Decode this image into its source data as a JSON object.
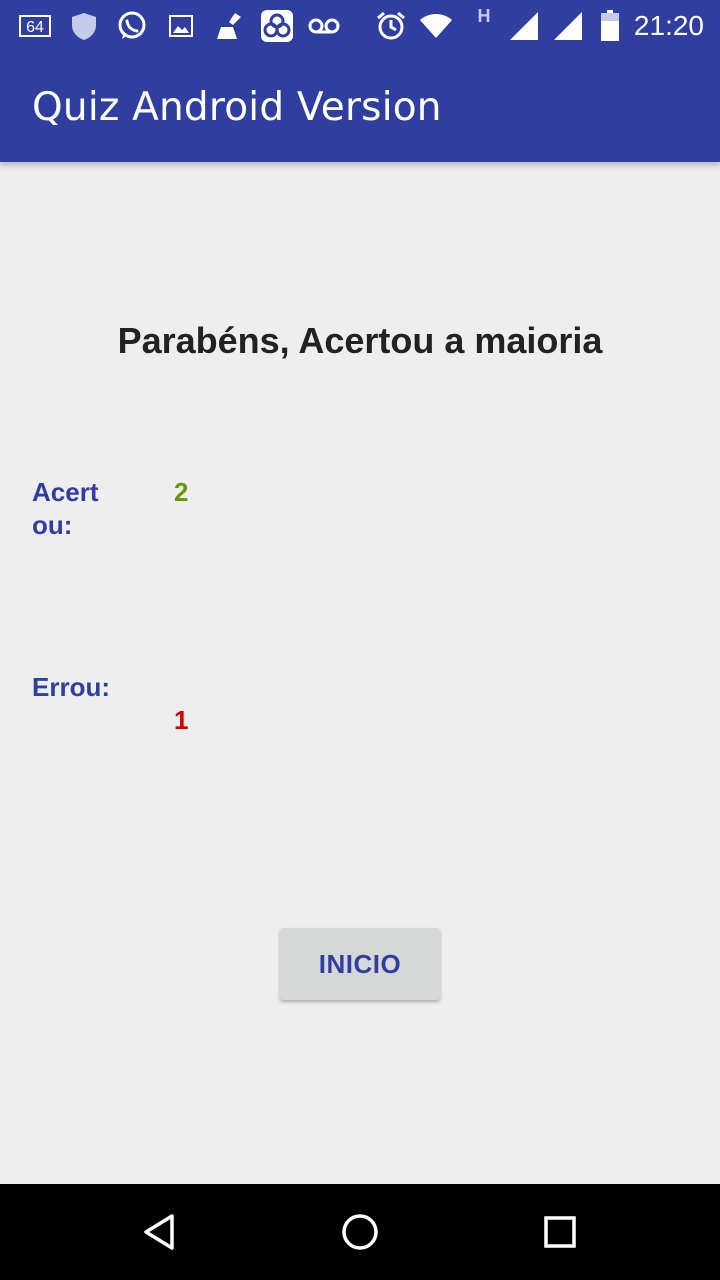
{
  "status_bar": {
    "time": "21:20",
    "network_type": "H",
    "notification_badge": "64",
    "icons": [
      "notification-64-icon",
      "shield-icon",
      "whatsapp-icon",
      "image-icon",
      "cleaner-icon",
      "app-icon",
      "voicemail-icon",
      "alarm-icon",
      "wifi-icon",
      "signal-icon",
      "signal-icon",
      "battery-icon"
    ]
  },
  "app_bar": {
    "title": "Quiz Android Version"
  },
  "result": {
    "headline": "Parabéns, Acertou a maioria",
    "correct_label": "Acertou:",
    "correct_value": "2",
    "wrong_label": "Errou:",
    "wrong_value": "1"
  },
  "buttons": {
    "start_label": "INICIO"
  },
  "colors": {
    "primary": "#303f9f",
    "correct": "#669900",
    "wrong": "#cc0000",
    "background": "#eeeeee"
  },
  "nav_bar": {
    "icons": [
      "back-icon",
      "home-icon",
      "recents-icon"
    ]
  }
}
